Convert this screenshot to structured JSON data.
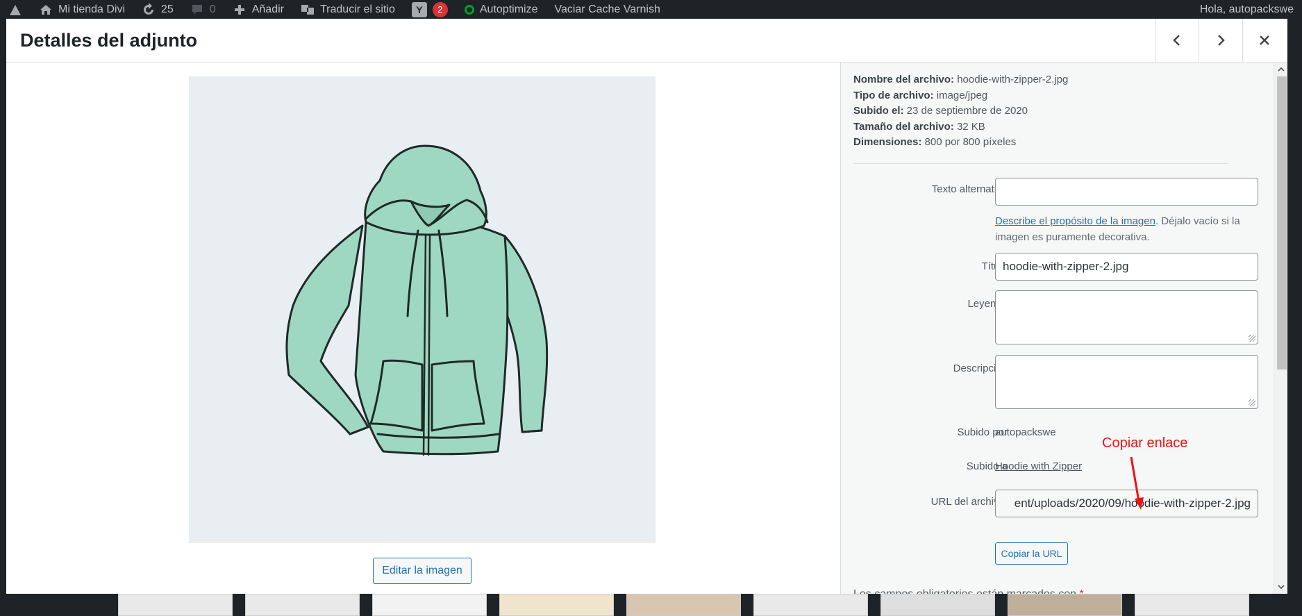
{
  "admin_bar": {
    "site_name": "Mi tienda Divi",
    "updates_count": "25",
    "comments_count": "0",
    "add_label": "Añadir",
    "translate_label": "Traducir el sitio",
    "yoast_badge": "2",
    "autoptimize_label": "Autoptimize",
    "varnish_label": "Vaciar Cache Varnish",
    "greeting": "Hola, autopackswe"
  },
  "modal": {
    "title": "Detalles del adjunto"
  },
  "media": {
    "edit_button_label": "Editar la imagen"
  },
  "details": {
    "file_name_label": "Nombre del archivo:",
    "file_name": "hoodie-with-zipper-2.jpg",
    "file_type_label": "Tipo de archivo:",
    "file_type": "image/jpeg",
    "uploaded_on_label": "Subido el:",
    "uploaded_on": "23 de septiembre de 2020",
    "file_size_label": "Tamaño del archivo:",
    "file_size": "32 KB",
    "dimensions_label": "Dimensiones:",
    "dimensions": "800 por 800 píxeles"
  },
  "form": {
    "alt_label": "Texto alternativo",
    "alt_value": "",
    "alt_help_link": "Describe el propósito de la imagen",
    "alt_help_text": ". Déjalo vacío si la imagen es puramente decorativa.",
    "title_label": "Título",
    "title_value": "hoodie-with-zipper-2.jpg",
    "caption_label": "Leyenda",
    "caption_value": "",
    "description_label": "Descripción",
    "description_value": "",
    "uploaded_by_label": "Subido por",
    "uploaded_by": "autopackswe",
    "uploaded_to_label": "Subido a",
    "uploaded_to": "Hoodie with Zipper",
    "file_url_label": "URL del archivo:",
    "file_url_visible": "ent/uploads/2020/09/hoodie-with-zipper-2.jpg",
    "copy_url_label": "Copiar la URL",
    "required_note": "Los campos obligatorios están marcados con",
    "required_star": "*"
  },
  "annotation": {
    "text": "Copiar enlace",
    "color": "#ee1111"
  },
  "colors": {
    "accent": "#2271b1",
    "admin_bar": "#1d2327",
    "sidebar_bg": "#f6f7f7",
    "hoodie": "#9fd8c2"
  },
  "icons": {
    "wordpress": "wordpress-icon",
    "updates": "refresh-icon",
    "comments": "comment-icon",
    "add": "plus-icon",
    "translate": "translate-icon",
    "previous": "chevron-left-icon",
    "next": "chevron-right-icon",
    "close": "close-icon"
  }
}
